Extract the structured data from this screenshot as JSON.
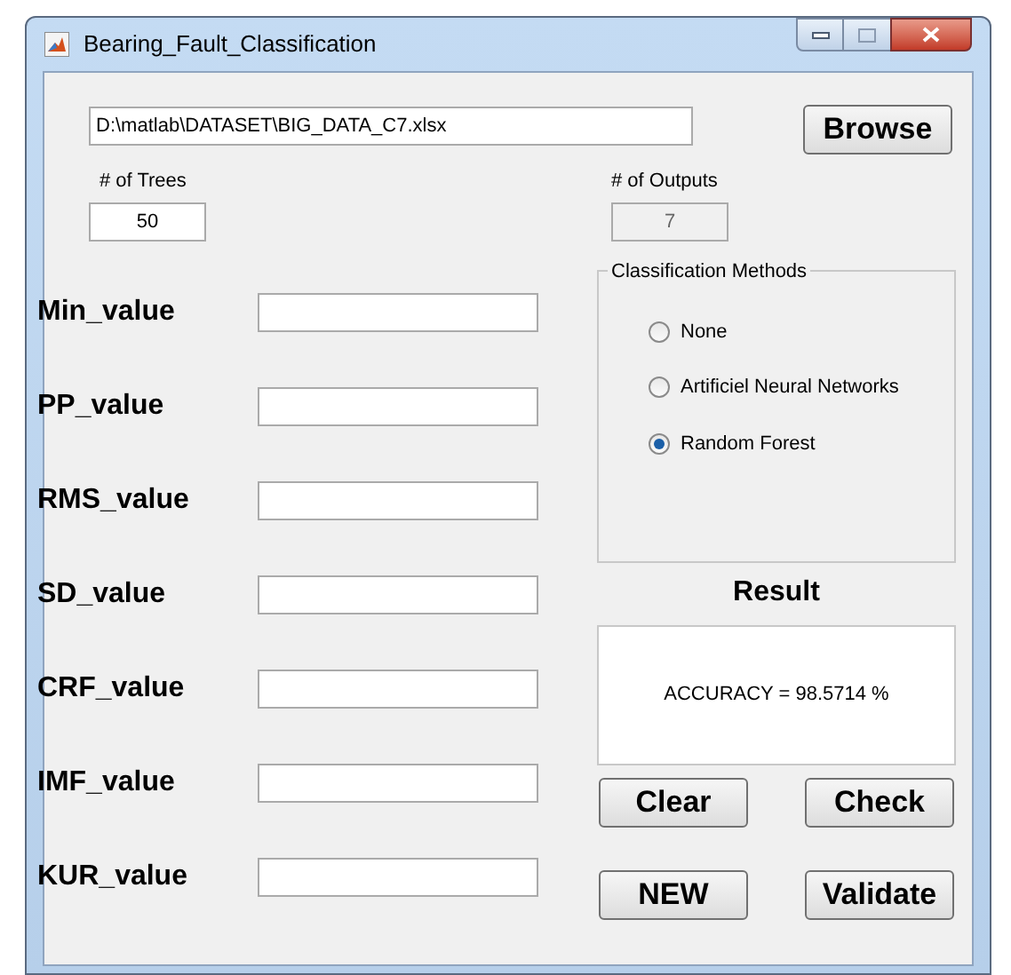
{
  "window": {
    "title": "Bearing_Fault_Classification"
  },
  "file_path": {
    "value": "D:\\matlab\\DATASET\\BIG_DATA_C7.xlsx"
  },
  "browse_button": "Browse",
  "trees": {
    "label": "# of Trees",
    "value": "50"
  },
  "outputs": {
    "label": "# of Outputs",
    "value": "7",
    "disabled": true
  },
  "features": [
    {
      "label": "Min_value"
    },
    {
      "label": "PP_value"
    },
    {
      "label": "RMS_value"
    },
    {
      "label": "SD_value"
    },
    {
      "label": "CRF_value"
    },
    {
      "label": "IMF_value"
    },
    {
      "label": "KUR_value"
    }
  ],
  "methods": {
    "title": "Classification Methods",
    "options": [
      {
        "label": "None",
        "selected": false
      },
      {
        "label": "Artificiel Neural Networks",
        "selected": false
      },
      {
        "label": "Random Forest",
        "selected": true
      }
    ]
  },
  "result": {
    "title": "Result",
    "text": "ACCURACY = 98.5714 %"
  },
  "buttons": [
    "Clear",
    "Check",
    "NEW",
    "Validate"
  ]
}
